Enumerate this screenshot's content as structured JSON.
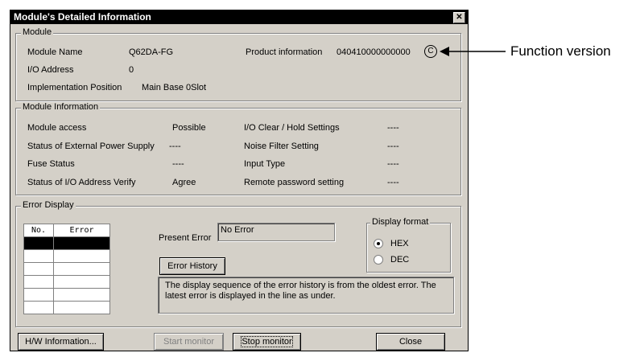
{
  "window": {
    "title": "Module's Detailed Information",
    "close_glyph": "✕"
  },
  "module_group": {
    "legend": "Module",
    "module_name_label": "Module Name",
    "module_name_value": "Q62DA-FG",
    "io_address_label": "I/O Address",
    "io_address_value": "0",
    "impl_pos_label": "Implementation Position",
    "impl_pos_value": "Main Base  0Slot",
    "product_info_label": "Product information",
    "product_info_value": "040410000000000",
    "function_version": "C"
  },
  "info_group": {
    "legend": "Module Information",
    "rows_left": [
      {
        "label": "Module access",
        "value": "Possible"
      },
      {
        "label": "Status of External Power Supply",
        "value": "----"
      },
      {
        "label": "Fuse Status",
        "value": "----"
      },
      {
        "label": "Status of I/O Address Verify",
        "value": "Agree"
      }
    ],
    "rows_right": [
      {
        "label": "I/O Clear / Hold Settings",
        "value": "----"
      },
      {
        "label": "Noise Filter Setting",
        "value": "----"
      },
      {
        "label": "Input Type",
        "value": "----"
      },
      {
        "label": "Remote password setting",
        "value": "----"
      }
    ]
  },
  "error_group": {
    "legend": "Error Display",
    "table_headers": [
      "No.",
      "Error"
    ],
    "present_error_label": "Present Error",
    "present_error_value": "No Error",
    "error_history_button": "Error History",
    "note": "The display sequence of the error history is from the oldest error. The latest error is displayed in the line as under.",
    "display_format_legend": "Display format",
    "format_options": [
      {
        "label": "HEX",
        "selected": true
      },
      {
        "label": "DEC",
        "selected": false
      }
    ]
  },
  "buttons": {
    "hw_info": "H/W Information...",
    "start_monitor": "Start monitor",
    "stop_monitor": "Stop monitor",
    "close": "Close"
  },
  "annotation": {
    "label": "Function version"
  }
}
